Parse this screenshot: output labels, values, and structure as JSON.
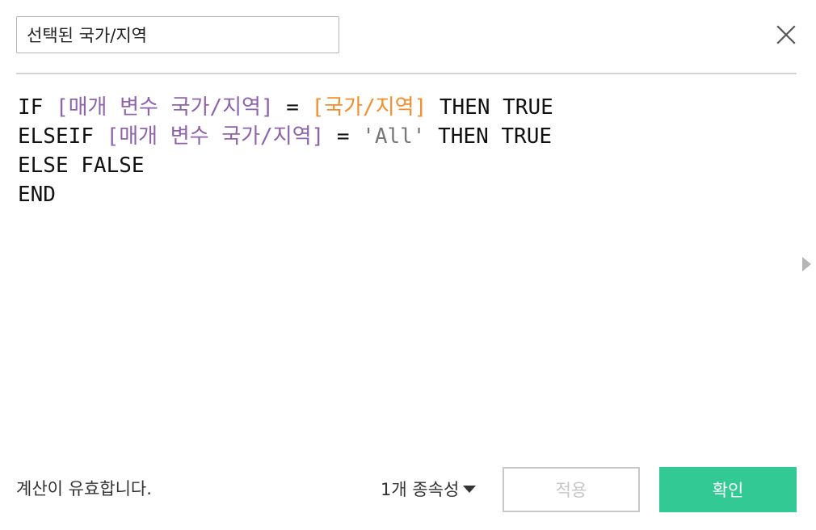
{
  "header": {
    "calc_name": "선택된 국가/지역"
  },
  "editor": {
    "lines": [
      {
        "tokens": [
          {
            "type": "kw",
            "text": "IF "
          },
          {
            "type": "field",
            "text": "[매개 변수 국가/지역]"
          },
          {
            "type": "kw",
            "text": " = "
          },
          {
            "type": "field-src",
            "text": "[국가/지역]"
          },
          {
            "type": "kw",
            "text": " THEN TRUE"
          }
        ]
      },
      {
        "tokens": [
          {
            "type": "kw",
            "text": "ELSEIF "
          },
          {
            "type": "field",
            "text": "[매개 변수 국가/지역]"
          },
          {
            "type": "kw",
            "text": " = "
          },
          {
            "type": "str",
            "text": "'All'"
          },
          {
            "type": "kw",
            "text": " THEN TRUE"
          }
        ]
      },
      {
        "tokens": [
          {
            "type": "kw",
            "text": "ELSE FALSE"
          }
        ]
      },
      {
        "tokens": [
          {
            "type": "kw",
            "text": "END"
          }
        ]
      }
    ]
  },
  "footer": {
    "status": "계산이 유효합니다.",
    "dependencies_label": "1개 종속성",
    "apply_label": "적용",
    "ok_label": "확인"
  },
  "colors": {
    "field": "#8e63a9",
    "field_src": "#f28e2b",
    "string": "#777777",
    "keyword": "#111111",
    "ok_button": "#33c995"
  },
  "icons": {
    "close": "close-icon",
    "dropdown": "caret-down-icon",
    "side_panel_toggle": "triangle-right-icon"
  }
}
